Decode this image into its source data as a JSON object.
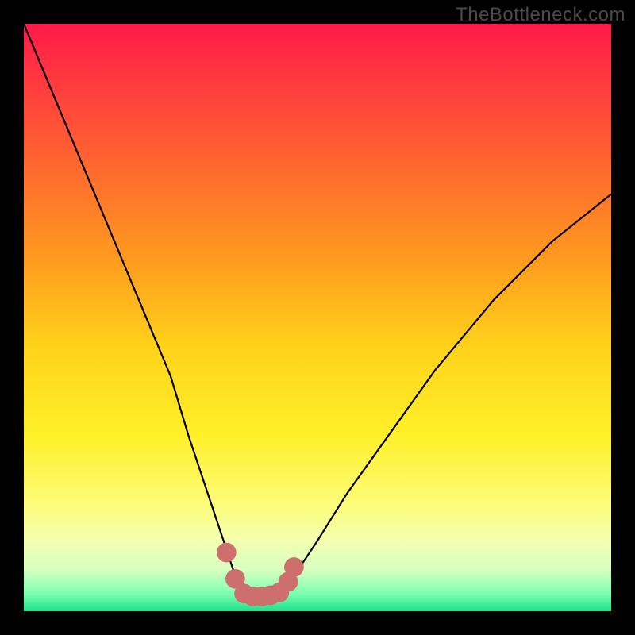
{
  "watermark": "TheBottleneck.com",
  "colors": {
    "frame": "#000000",
    "curve": "#000000",
    "marker_fill": "#cd6f6c",
    "marker_stroke": "#cd6f6c",
    "gradient_stops": [
      {
        "offset": 0.0,
        "color": "#ff1a49"
      },
      {
        "offset": 0.1,
        "color": "#ff3a3f"
      },
      {
        "offset": 0.25,
        "color": "#ff6a2e"
      },
      {
        "offset": 0.4,
        "color": "#ff9a1f"
      },
      {
        "offset": 0.55,
        "color": "#ffd21a"
      },
      {
        "offset": 0.7,
        "color": "#fff028"
      },
      {
        "offset": 0.82,
        "color": "#fdfc7a"
      },
      {
        "offset": 0.88,
        "color": "#f3ffb0"
      },
      {
        "offset": 0.93,
        "color": "#d6ffc0"
      },
      {
        "offset": 0.97,
        "color": "#7dffb0"
      },
      {
        "offset": 1.0,
        "color": "#1de28a"
      }
    ]
  },
  "chart_data": {
    "type": "line",
    "title": "",
    "xlabel": "",
    "ylabel": "",
    "xlim": [
      0,
      100
    ],
    "ylim": [
      0,
      100
    ],
    "note": "Axes are unlabeled; values are read as percent of plot area (0=left/bottom, 100=right/top). Curve is a V-shaped bottleneck profile with a flat minimum near x≈37–44 at y≈2.5.",
    "series": [
      {
        "name": "bottleneck-curve",
        "x": [
          0,
          5,
          10,
          15,
          20,
          25,
          28,
          31,
          34,
          36,
          38,
          40,
          42,
          44,
          46,
          50,
          55,
          60,
          65,
          70,
          75,
          80,
          85,
          90,
          95,
          100
        ],
        "y": [
          100,
          88,
          76,
          64,
          52,
          40,
          30,
          21,
          12,
          6,
          3.0,
          2.5,
          2.5,
          3.0,
          6,
          12,
          20,
          27,
          34,
          41,
          47,
          53,
          58,
          63,
          67,
          71
        ]
      }
    ],
    "markers": {
      "name": "highlight-points",
      "color": "#cd6f6c",
      "radius_pct": 1.6,
      "x": [
        34.5,
        36.0,
        37.5,
        39.0,
        40.5,
        42.0,
        43.5,
        45.0,
        46.0
      ],
      "y": [
        10.0,
        5.5,
        3.0,
        2.5,
        2.5,
        2.7,
        3.2,
        5.0,
        7.5
      ]
    }
  }
}
